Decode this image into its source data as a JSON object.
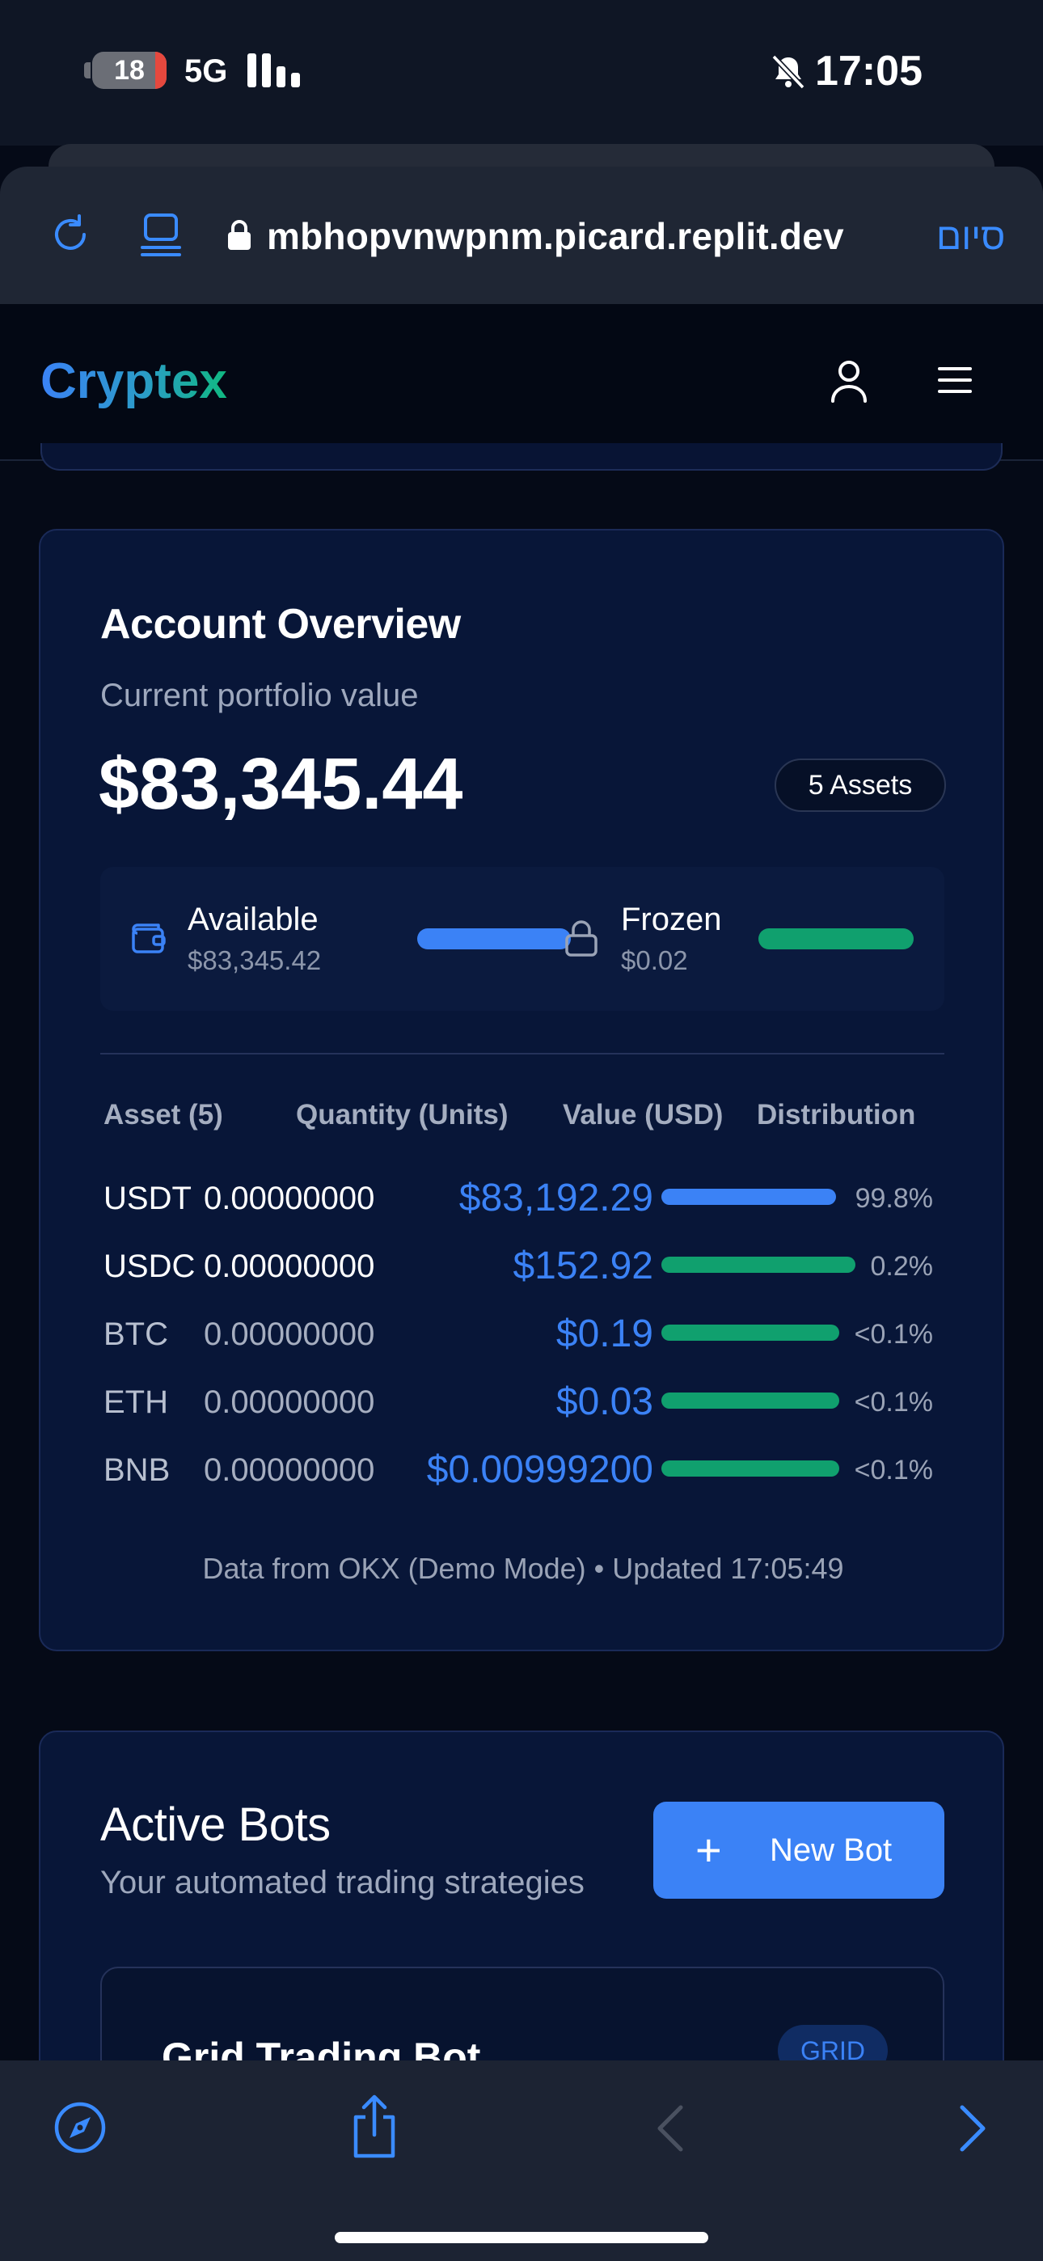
{
  "status_bar": {
    "battery_level": "18",
    "network": "5G",
    "time": "17:05",
    "icons": [
      "signal-bars-icon",
      "bell-slash-icon"
    ]
  },
  "browser": {
    "url": "mbhopvnwpnm.picard.replit.dev",
    "done_label": "סיום",
    "icons": [
      "reload-icon",
      "reader-mode-icon",
      "lock-icon",
      "compass-icon",
      "share-icon",
      "back-icon",
      "forward-icon"
    ]
  },
  "app": {
    "logo": "Cryptex",
    "icons": [
      "user-icon",
      "hamburger-menu-icon"
    ]
  },
  "overview": {
    "title": "Account Overview",
    "subtitle": "Current portfolio value",
    "total": "$83,345.44",
    "assets_badge": "5 Assets",
    "available": {
      "label": "Available",
      "value": "$83,345.42",
      "bar_fill": 1.0
    },
    "frozen": {
      "label": "Frozen",
      "value": "$0.02",
      "bar_fill": 1.0
    },
    "table": {
      "headers": [
        "Asset (5)",
        "Quantity (Units)",
        "Value (USD)",
        "Distribution"
      ],
      "rows": [
        {
          "asset": "USDT",
          "quantity": "0.00000000",
          "value": "$83,192.29",
          "pct": "99.8%",
          "color": "#3b82f6"
        },
        {
          "asset": "USDC",
          "quantity": "0.00000000",
          "value": "$152.92",
          "pct": "0.2%",
          "color": "#10a06e"
        },
        {
          "asset": "BTC",
          "quantity": "0.00000000",
          "value": "$0.19",
          "pct": "<0.1%",
          "color": "#10a06e"
        },
        {
          "asset": "ETH",
          "quantity": "0.00000000",
          "value": "$0.03",
          "pct": "<0.1%",
          "color": "#10a06e"
        },
        {
          "asset": "BNB",
          "quantity": "0.00000000",
          "value": "$0.00999200",
          "pct": "<0.1%",
          "color": "#10a06e"
        }
      ]
    },
    "footer": "Data from OKX (Demo Mode) • Updated 17:05:49"
  },
  "bots": {
    "title": "Active Bots",
    "subtitle": "Your automated trading strategies",
    "new_bot_label": "New Bot",
    "first_bot": {
      "name": "Grid Trading Bot",
      "type": "GRID"
    }
  },
  "colors": {
    "accent_blue": "#3b82f6",
    "accent_green": "#10a06e",
    "card_bg": "#081638",
    "page_bg": "#050a17"
  }
}
